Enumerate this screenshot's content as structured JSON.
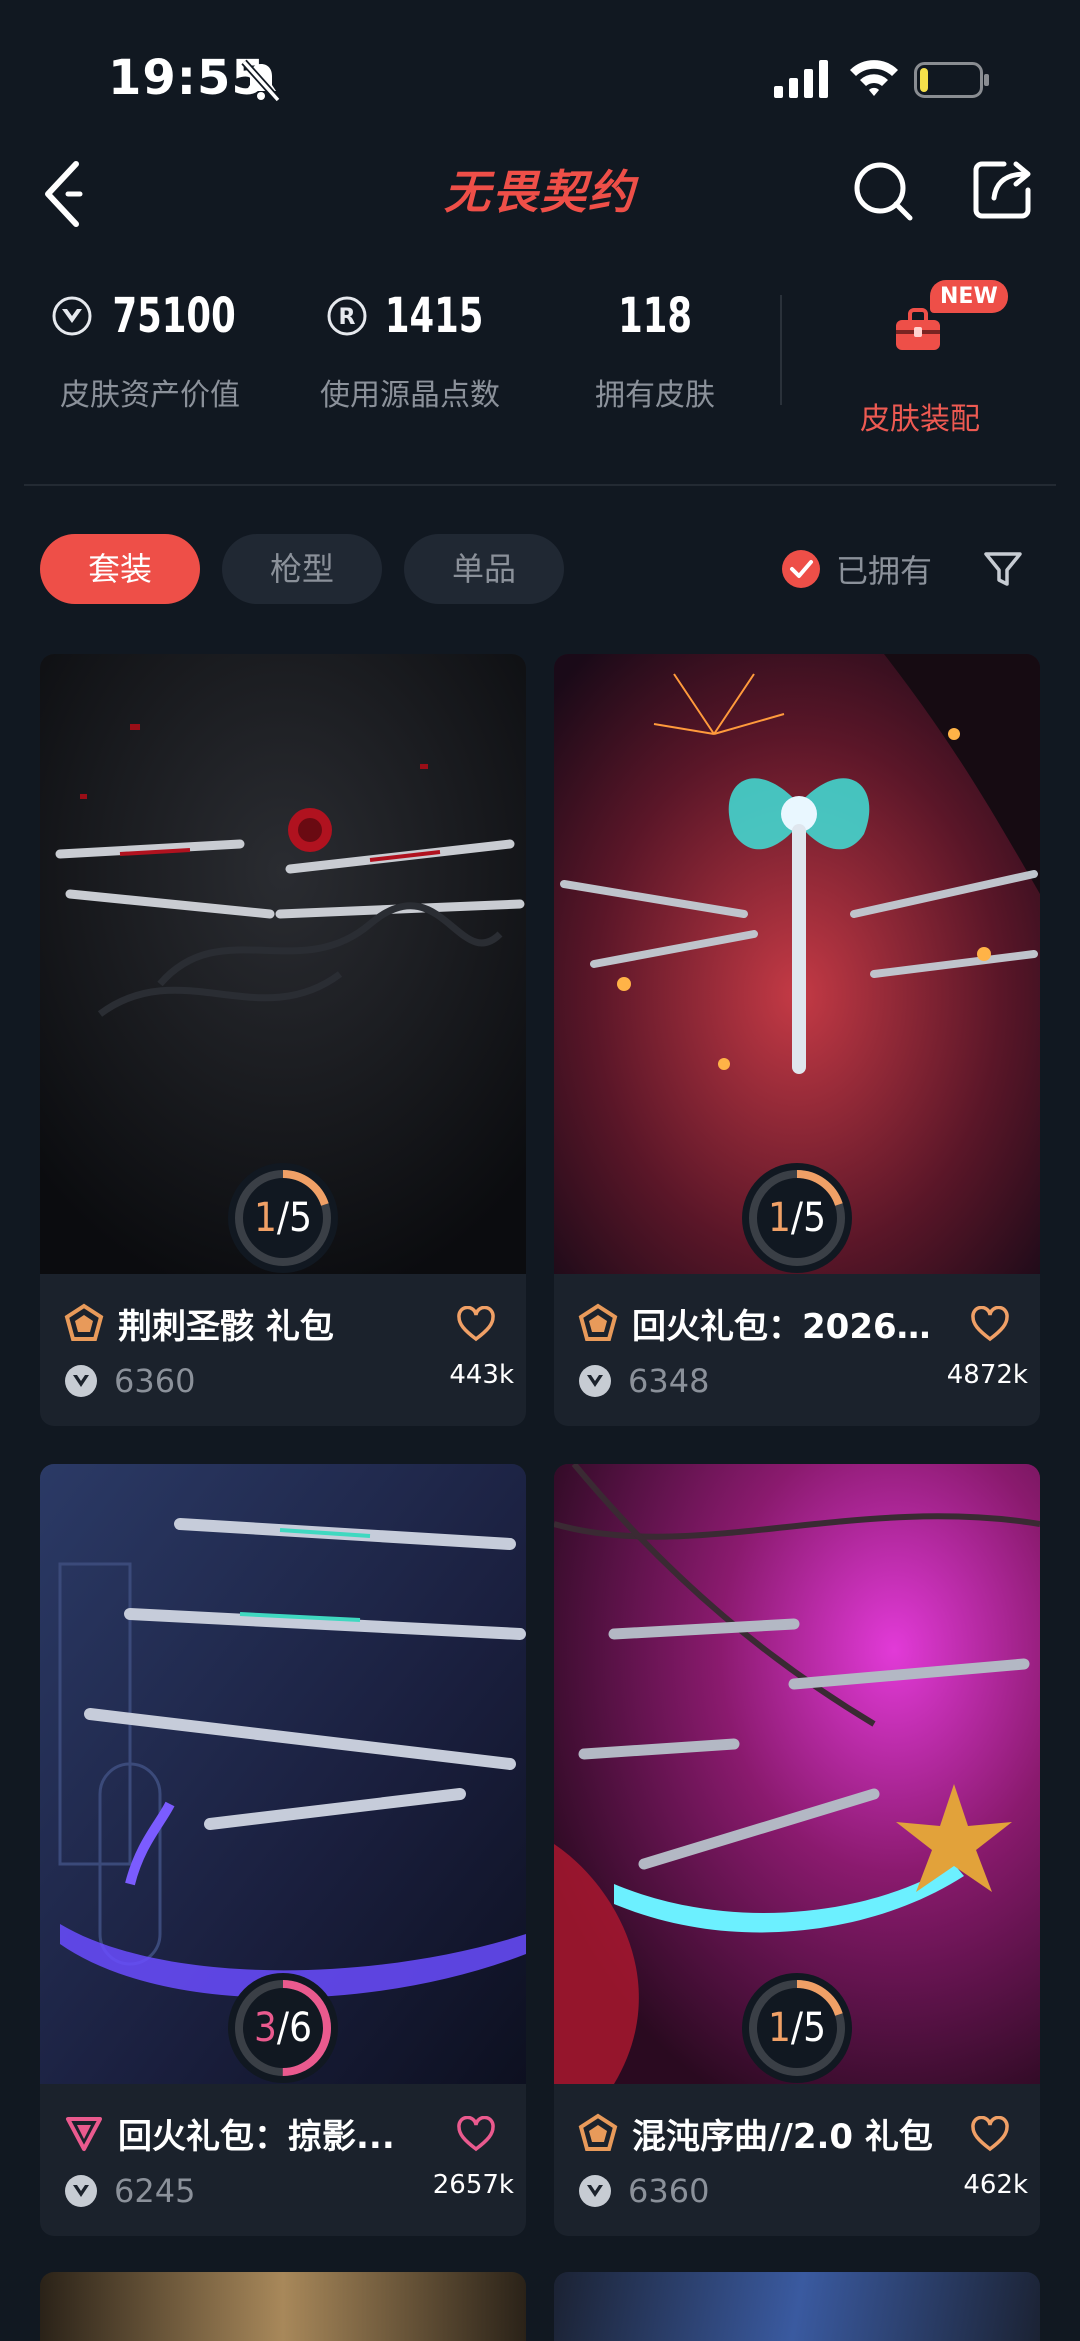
{
  "status": {
    "time": "19:55"
  },
  "header": {
    "logo_text": "无畏契约"
  },
  "stats": {
    "asset_value": "75100",
    "asset_label": "皮肤资产价值",
    "radianite": "1415",
    "radianite_label": "使用源晶点数",
    "owned": "118",
    "owned_label": "拥有皮肤",
    "equip_label": "皮肤装配",
    "new_badge": "NEW"
  },
  "filters": {
    "tabs": [
      "套装",
      "枪型",
      "单品"
    ],
    "owned_label": "已拥有"
  },
  "colors": {
    "accent": "#ee4f48",
    "background": "#111821",
    "card": "#1b222c"
  },
  "cards": [
    {
      "title": "荆刺圣骸 礼包",
      "price": "6360",
      "likes": "443k",
      "progress_current": "1",
      "progress_total": "5",
      "progress_fraction": 0.2,
      "tier": "gold"
    },
    {
      "title": "回火礼包：2026...",
      "price": "6348",
      "likes": "4872k",
      "progress_current": "1",
      "progress_total": "5",
      "progress_fraction": 0.2,
      "tier": "gold"
    },
    {
      "title": "回火礼包：掠影...",
      "price": "6245",
      "likes": "2657k",
      "progress_current": "3",
      "progress_total": "6",
      "progress_fraction": 0.5,
      "tier": "pink"
    },
    {
      "title": "混沌序曲//2.0 礼包",
      "price": "6360",
      "likes": "462k",
      "progress_current": "1",
      "progress_total": "5",
      "progress_fraction": 0.2,
      "tier": "gold"
    }
  ]
}
